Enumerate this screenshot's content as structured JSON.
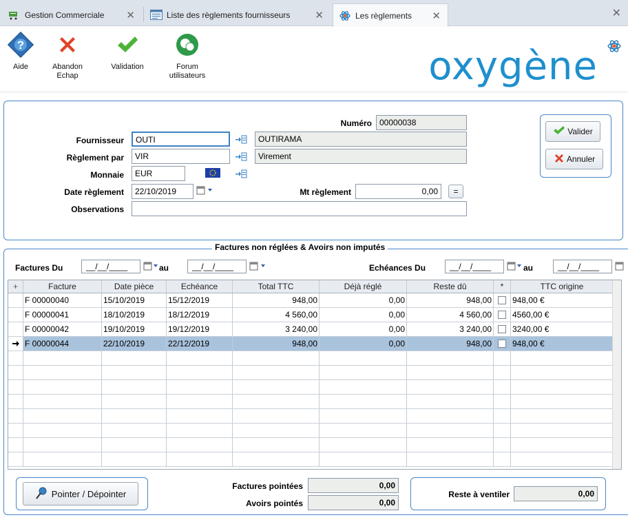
{
  "tabs": [
    {
      "label": "Gestion Commerciale"
    },
    {
      "label": "Liste des règlements fournisseurs"
    },
    {
      "label": "Les règlements"
    }
  ],
  "toolbar": {
    "help": "Aide",
    "cancel_line1": "Abandon",
    "cancel_line2": "Echap",
    "validate": "Validation",
    "forum_line1": "Forum",
    "forum_line2": "utilisateurs"
  },
  "logo_text": "oxygène",
  "form": {
    "numero_label": "Numéro",
    "numero_value": "00000038",
    "fournisseur_label": "Fournisseur",
    "fournisseur_code": "OUTI",
    "fournisseur_name": "OUTIRAMA",
    "reglement_label": "Règlement par",
    "reglement_code": "VIR",
    "reglement_name": "Virement",
    "monnaie_label": "Monnaie",
    "monnaie_value": "EUR",
    "date_label": "Date règlement",
    "date_value": "22/10/2019",
    "mt_label": "Mt règlement",
    "mt_value": "0,00",
    "equal_btn": "=",
    "observations_label": "Observations",
    "observations_value": ""
  },
  "actions": {
    "valider": "Valider",
    "annuler": "Annuler"
  },
  "invoices_section": {
    "title": "Factures non réglées & Avoirs non imputés",
    "factures_du_label": "Factures Du",
    "factures_du_value": "__/__/____",
    "au_label": "au",
    "factures_au_value": "__/__/____",
    "echeances_du_label": "Echéances Du",
    "echeances_du_value": "__/__/____",
    "echeances_au_value": "__/__/____"
  },
  "grid": {
    "columns": [
      "Facture",
      "Date pièce",
      "Echéance",
      "Total TTC",
      "Déjà réglé",
      "Reste dû",
      "*",
      "TTC origine"
    ],
    "rows": [
      {
        "facture": "F 00000040",
        "date": "15/10/2019",
        "echeance": "15/12/2019",
        "total": "948,00",
        "deja": "0,00",
        "reste": "948,00",
        "origine": "948,00 €"
      },
      {
        "facture": "F 00000041",
        "date": "18/10/2019",
        "echeance": "18/12/2019",
        "total": "4 560,00",
        "deja": "0,00",
        "reste": "4 560,00",
        "origine": "4560,00 €"
      },
      {
        "facture": "F 00000042",
        "date": "19/10/2019",
        "echeance": "19/12/2019",
        "total": "3 240,00",
        "deja": "0,00",
        "reste": "3 240,00",
        "origine": "3240,00 €"
      },
      {
        "facture": "F 00000044",
        "date": "22/10/2019",
        "echeance": "22/12/2019",
        "total": "948,00",
        "deja": "0,00",
        "reste": "948,00",
        "origine": "948,00 €"
      }
    ],
    "selected_row": 3
  },
  "footer": {
    "pointer_button": "Pointer / Dépointer",
    "factures_pointees_label": "Factures pointées",
    "factures_pointees_value": "0,00",
    "avoirs_pointes_label": "Avoirs pointés",
    "avoirs_pointes_value": "0,00",
    "reste_label": "Reste à ventiler",
    "reste_value": "0,00"
  },
  "colors": {
    "accent": "#4a86c6",
    "logo": "#1f8fce",
    "selected_row": "#a9c3dd"
  }
}
